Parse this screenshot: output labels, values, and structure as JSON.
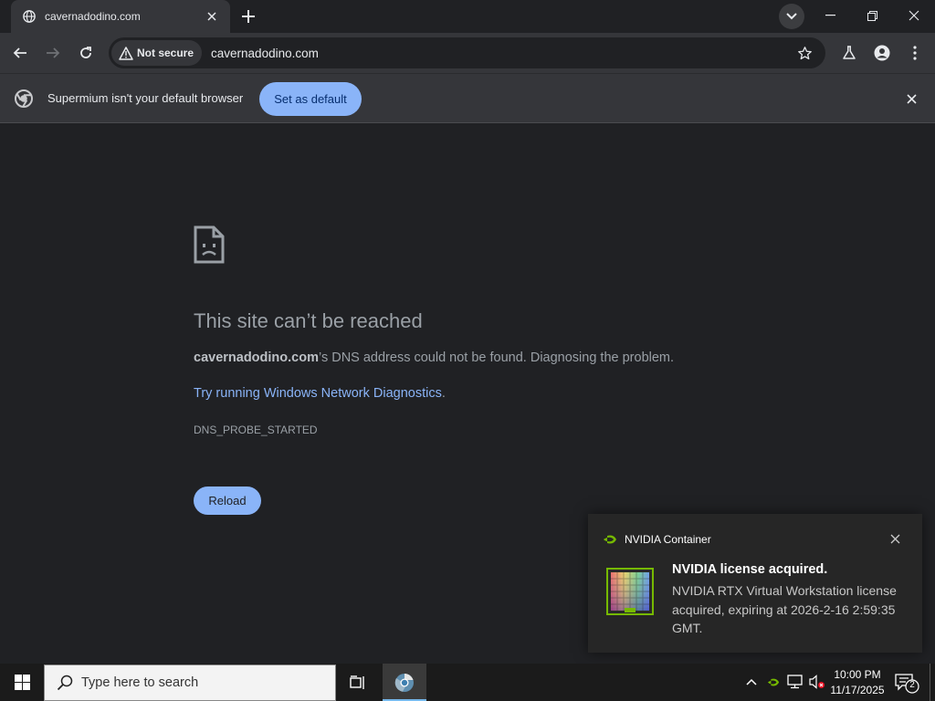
{
  "tab": {
    "title": "cavernadodino.com",
    "icon": "globe-icon"
  },
  "window_controls": [
    "minimize-icon",
    "restore-icon",
    "close-icon"
  ],
  "omnibox": {
    "security_label": "Not secure",
    "url": "cavernadodino.com"
  },
  "infobar": {
    "message": "Supermium isn't your default browser",
    "button_label": "Set as default"
  },
  "error_page": {
    "title": "This site can’t be reached",
    "host": "cavernadodino.com",
    "message_rest": "’s DNS address could not be found. Diagnosing the problem.",
    "link_text": "Try running Windows Network Diagnostics",
    "link_suffix": ".",
    "error_code": "DNS_PROBE_STARTED",
    "reload_label": "Reload"
  },
  "toast": {
    "app_name": "NVIDIA Container",
    "title": "NVIDIA license acquired.",
    "body": "NVIDIA RTX Virtual Workstation license acquired, expiring at 2026-2-16 2:59:35 GMT."
  },
  "taskbar": {
    "search_placeholder": "Type here to search",
    "time": "10:00 PM",
    "date": "11/17/2025",
    "notification_count": "2"
  },
  "colors": {
    "accent": "#8ab4f8",
    "nvidia_green": "#76b900",
    "background": "#202124"
  }
}
